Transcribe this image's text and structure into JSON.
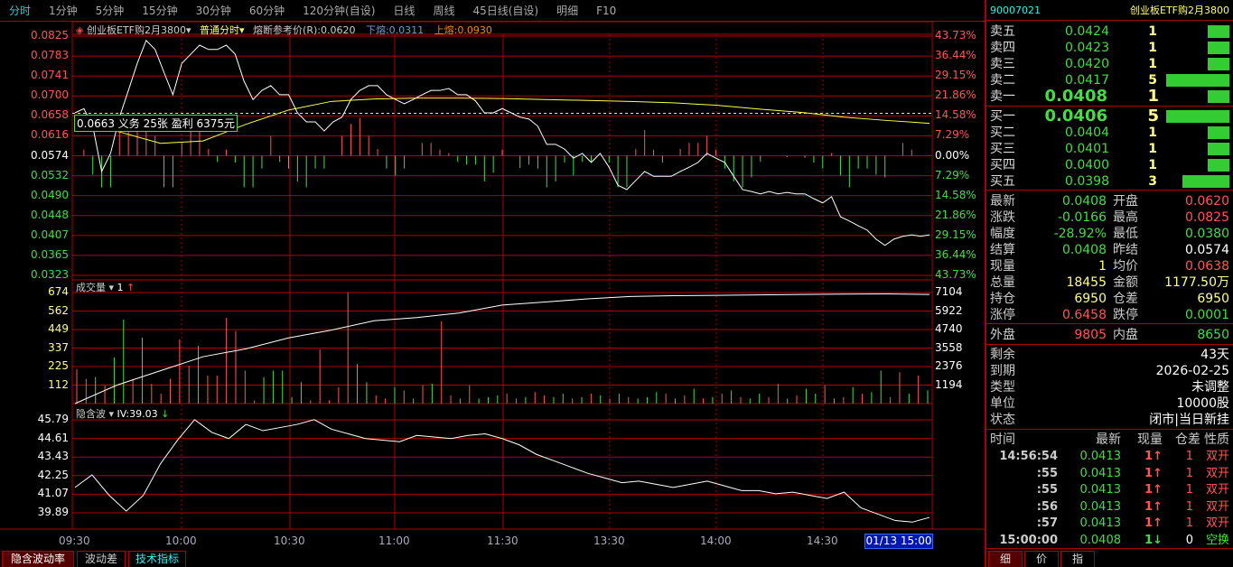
{
  "topbar": {
    "tabs": [
      "分时",
      "1分钟",
      "5分钟",
      "15分钟",
      "30分钟",
      "60分钟",
      "120分钟(自设)",
      "日线",
      "周线",
      "45日线(自设)",
      "明细",
      "F10"
    ],
    "active": 0
  },
  "header": {
    "name": "创业板ETF购2月3800",
    "mode": "普通分时",
    "ref_label": "熔断参考价(R):0.0620",
    "lower_label": "下熔:0.0311",
    "upper_label": "上熔:0.0930"
  },
  "tooltip": "0.0663 义务 25张 盈利 6375元",
  "price_axis": {
    "left": [
      "0.0825",
      "0.0783",
      "0.0741",
      "0.0700",
      "0.0658",
      "0.0616",
      "0.0574",
      "0.0532",
      "0.0490",
      "0.0448",
      "0.0407",
      "0.0365",
      "0.0323"
    ],
    "right": [
      "43.73%",
      "36.44%",
      "29.15%",
      "21.86%",
      "14.58%",
      "7.29%",
      "0.00%",
      "7.29%",
      "14.58%",
      "21.86%",
      "29.15%",
      "36.44%",
      "43.73%"
    ],
    "max": 0.0825,
    "min": 0.0323,
    "prev": 0.0574
  },
  "colors": {
    "up": "#ff5555",
    "down": "#44dd44",
    "grid": "#b00000",
    "line": "#ffffff",
    "avg": "#ffff44"
  },
  "price_series": [
    0.0664,
    0.0673,
    0.0636,
    0.0541,
    0.0579,
    0.0655,
    0.0711,
    0.0768,
    0.0816,
    0.0797,
    0.0749,
    0.0702,
    0.0768,
    0.0787,
    0.0806,
    0.0797,
    0.0797,
    0.0806,
    0.0787,
    0.073,
    0.0692,
    0.0711,
    0.0721,
    0.0702,
    0.0702,
    0.0664,
    0.0645,
    0.0645,
    0.0626,
    0.0645,
    0.0655,
    0.0692,
    0.0711,
    0.0721,
    0.0721,
    0.0702,
    0.0692,
    0.0683,
    0.0692,
    0.0702,
    0.0711,
    0.0711,
    0.0715,
    0.0702,
    0.0702,
    0.0689,
    0.0664,
    0.0664,
    0.0673,
    0.0664,
    0.0655,
    0.0651,
    0.0636,
    0.0598,
    0.0598,
    0.0588,
    0.0569,
    0.0579,
    0.056,
    0.0579,
    0.055,
    0.0512,
    0.0503,
    0.0522,
    0.0541,
    0.0531,
    0.0531,
    0.0531,
    0.0541,
    0.055,
    0.056,
    0.0579,
    0.0569,
    0.056,
    0.0531,
    0.0503,
    0.0499,
    0.0494,
    0.0499,
    0.0494,
    0.0497,
    0.0494,
    0.0494,
    0.0484,
    0.0475,
    0.0488,
    0.0446,
    0.0437,
    0.0427,
    0.0418,
    0.0399,
    0.0386,
    0.0399,
    0.0405,
    0.0408,
    0.0405,
    0.0408
  ],
  "avg_series": [
    0.064,
    0.0625,
    0.06,
    0.0605,
    0.064,
    0.067,
    0.0688,
    0.0693,
    0.0695,
    0.0695,
    0.0694,
    0.0692,
    0.069,
    0.0688,
    0.0685,
    0.068,
    0.0672,
    0.0665,
    0.0655,
    0.0648,
    0.0642
  ],
  "volume": {
    "label": "成交量",
    "count": "1",
    "axis_left": [
      "674",
      "562",
      "449",
      "337",
      "225",
      "112"
    ],
    "axis_right": [
      "7104",
      "5922",
      "4740",
      "3558",
      "2376",
      "1194"
    ],
    "max": 674,
    "cum_max": 7104,
    "bars": [
      [
        210,
        1
      ],
      [
        150,
        1
      ],
      [
        160,
        0
      ],
      [
        110,
        1
      ],
      [
        280,
        0
      ],
      [
        510,
        0
      ],
      [
        150,
        1
      ],
      [
        400,
        0
      ],
      [
        120,
        1
      ],
      [
        60,
        1
      ],
      [
        150,
        1
      ],
      [
        390,
        1
      ],
      [
        230,
        1
      ],
      [
        350,
        0
      ],
      [
        170,
        1
      ],
      [
        170,
        1
      ],
      [
        520,
        1
      ],
      [
        440,
        1
      ],
      [
        200,
        1
      ],
      [
        20,
        1
      ],
      [
        160,
        0
      ],
      [
        200,
        0
      ],
      [
        200,
        0
      ],
      [
        40,
        0
      ],
      [
        130,
        0
      ],
      [
        20,
        1
      ],
      [
        330,
        1
      ],
      [
        20,
        1
      ],
      [
        100,
        1
      ],
      [
        700,
        1
      ],
      [
        240,
        0
      ],
      [
        130,
        0
      ],
      [
        50,
        1
      ],
      [
        30,
        1
      ],
      [
        100,
        0
      ],
      [
        80,
        1
      ],
      [
        30,
        0
      ],
      [
        110,
        1
      ],
      [
        120,
        0
      ],
      [
        500,
        1
      ],
      [
        50,
        1
      ],
      [
        30,
        0
      ],
      [
        110,
        1
      ],
      [
        30,
        0
      ],
      [
        40,
        0
      ],
      [
        50,
        0
      ],
      [
        60,
        1
      ],
      [
        30,
        1
      ],
      [
        40,
        0
      ],
      [
        70,
        1
      ],
      [
        50,
        1
      ],
      [
        40,
        0
      ],
      [
        60,
        0
      ],
      [
        30,
        1
      ],
      [
        40,
        0
      ],
      [
        60,
        1
      ],
      [
        50,
        0
      ],
      [
        30,
        1
      ],
      [
        60,
        0
      ],
      [
        40,
        1
      ],
      [
        30,
        0
      ],
      [
        40,
        0
      ],
      [
        70,
        0
      ],
      [
        60,
        1
      ],
      [
        30,
        0
      ],
      [
        50,
        1
      ],
      [
        90,
        0
      ],
      [
        30,
        1
      ],
      [
        40,
        0
      ],
      [
        60,
        1
      ],
      [
        80,
        0
      ],
      [
        40,
        1
      ],
      [
        30,
        0
      ],
      [
        60,
        0
      ],
      [
        40,
        1
      ],
      [
        120,
        1
      ],
      [
        30,
        0
      ],
      [
        50,
        1
      ],
      [
        90,
        0
      ],
      [
        60,
        0
      ],
      [
        110,
        1
      ],
      [
        30,
        0
      ],
      [
        40,
        1
      ],
      [
        100,
        0
      ],
      [
        60,
        1
      ],
      [
        70,
        0
      ],
      [
        200,
        0
      ],
      [
        40,
        1
      ],
      [
        190,
        1
      ],
      [
        60,
        0
      ],
      [
        170,
        1
      ],
      [
        80,
        0
      ]
    ],
    "cum_series": [
      0,
      1200,
      2100,
      3000,
      3500,
      4200,
      4700,
      5300,
      5500,
      5800,
      6300,
      6500,
      6700,
      6850,
      6900,
      6920,
      6950,
      6980,
      7000,
      7020,
      6980
    ]
  },
  "iv": {
    "label": "隐含波",
    "value": "IV:39.03",
    "axis": [
      "45.79",
      "44.61",
      "43.43",
      "42.25",
      "41.07",
      "39.89"
    ],
    "max": 45.79,
    "min": 39.89,
    "series": [
      41.5,
      42.3,
      41.0,
      40.0,
      41.0,
      43.0,
      44.5,
      45.8,
      45.0,
      44.6,
      45.5,
      45.1,
      45.3,
      45.5,
      45.8,
      45.2,
      44.9,
      44.6,
      44.5,
      44.4,
      44.8,
      44.7,
      44.6,
      44.8,
      44.9,
      44.6,
      44.2,
      43.6,
      43.2,
      42.8,
      42.4,
      42.1,
      41.8,
      41.9,
      41.7,
      41.5,
      41.7,
      41.9,
      41.6,
      41.3,
      41.3,
      41.1,
      41.2,
      41.0,
      40.8,
      41.2,
      40.2,
      39.8,
      39.4,
      39.3,
      39.6
    ]
  },
  "time_axis": [
    "09:30",
    "10:00",
    "10:30",
    "11:00",
    "11:30",
    "13:30",
    "14:00",
    "14:30"
  ],
  "time_cursor": "01/13 15:00",
  "bottom_tabs": [
    "隐含波动率",
    "波动差",
    "技术指标"
  ],
  "quote": {
    "code": "90007021",
    "name": "创业板ETF购2月3800",
    "asks": [
      {
        "label": "卖五",
        "price": "0.0424",
        "vol": "1",
        "q": 1
      },
      {
        "label": "卖四",
        "price": "0.0423",
        "vol": "1",
        "q": 1
      },
      {
        "label": "卖三",
        "price": "0.0420",
        "vol": "1",
        "q": 1
      },
      {
        "label": "卖二",
        "price": "0.0417",
        "vol": "5",
        "q": 5
      },
      {
        "label": "卖一",
        "price": "0.0408",
        "vol": "1",
        "q": 1
      }
    ],
    "bids": [
      {
        "label": "买一",
        "price": "0.0406",
        "vol": "5",
        "q": 5
      },
      {
        "label": "买二",
        "price": "0.0404",
        "vol": "1",
        "q": 1
      },
      {
        "label": "买三",
        "price": "0.0401",
        "vol": "1",
        "q": 1
      },
      {
        "label": "买四",
        "price": "0.0400",
        "vol": "1",
        "q": 1
      },
      {
        "label": "买五",
        "price": "0.0398",
        "vol": "3",
        "q": 3
      }
    ],
    "stats": [
      [
        "最新",
        "0.0408",
        "#44dd44",
        "开盘",
        "0.0620",
        "#ff5555"
      ],
      [
        "涨跌",
        "-0.0166",
        "#44dd44",
        "最高",
        "0.0825",
        "#ff5555"
      ],
      [
        "幅度",
        "-28.92%",
        "#44dd44",
        "最低",
        "0.0380",
        "#44dd44"
      ],
      [
        "结算",
        "0.0408",
        "#44dd44",
        "昨结",
        "0.0574",
        "#ffffff"
      ],
      [
        "现量",
        "1",
        "#ffff88",
        "均价",
        "0.0638",
        "#ff5555"
      ],
      [
        "总量",
        "18455",
        "#ffff88",
        "金额",
        "1177.50万",
        "#ffff88"
      ],
      [
        "持仓",
        "6950",
        "#ffff88",
        "仓差",
        "6950",
        "#ffff88"
      ],
      [
        "涨停",
        "0.6458",
        "#ff5555",
        "跌停",
        "0.0001",
        "#44dd44"
      ]
    ],
    "outer": {
      "label": "外盘",
      "value": "9805",
      "inner_label": "内盘",
      "inner_value": "8650"
    },
    "info": [
      [
        "剩余",
        "43天"
      ],
      [
        "到期",
        "2026-02-25"
      ],
      [
        "类型",
        "未调整"
      ],
      [
        "单位",
        "10000股"
      ],
      [
        "状态",
        "闭市|当日新挂"
      ]
    ],
    "ticks_header": [
      "时间",
      "最新",
      "现量",
      "仓差",
      "性质"
    ],
    "ticks": [
      [
        "14:56:54",
        "0.0413",
        "1",
        "↑",
        "1",
        "双开"
      ],
      [
        ":55",
        "0.0413",
        "1",
        "↑",
        "1",
        "双开"
      ],
      [
        ":55",
        "0.0413",
        "1",
        "↑",
        "1",
        "双开"
      ],
      [
        ":56",
        "0.0413",
        "1",
        "↑",
        "1",
        "双开"
      ],
      [
        ":57",
        "0.0413",
        "1",
        "↑",
        "1",
        "双开"
      ],
      [
        "15:00:00",
        "0.0408",
        "1",
        "↓",
        "0",
        "空换"
      ]
    ],
    "tabs": [
      "细",
      "价",
      "指"
    ]
  }
}
